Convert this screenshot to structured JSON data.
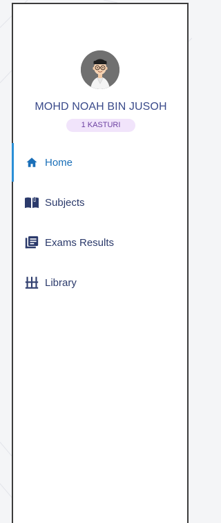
{
  "profile": {
    "name": "MOHD NOAH BIN JUSOH",
    "class_badge": "1 KASTURI"
  },
  "nav": {
    "items": [
      {
        "label": "Home",
        "icon": "home-icon",
        "active": true
      },
      {
        "label": "Subjects",
        "icon": "book-open-icon",
        "active": false
      },
      {
        "label": "Exams Results",
        "icon": "list-alt-icon",
        "active": false
      },
      {
        "label": "Library",
        "icon": "bookshelf-icon",
        "active": false
      }
    ]
  },
  "colors": {
    "active": "#1a6fb8",
    "text": "#2b3a6b",
    "badge_bg": "#f1e4fb",
    "badge_text": "#6b3fa0"
  }
}
